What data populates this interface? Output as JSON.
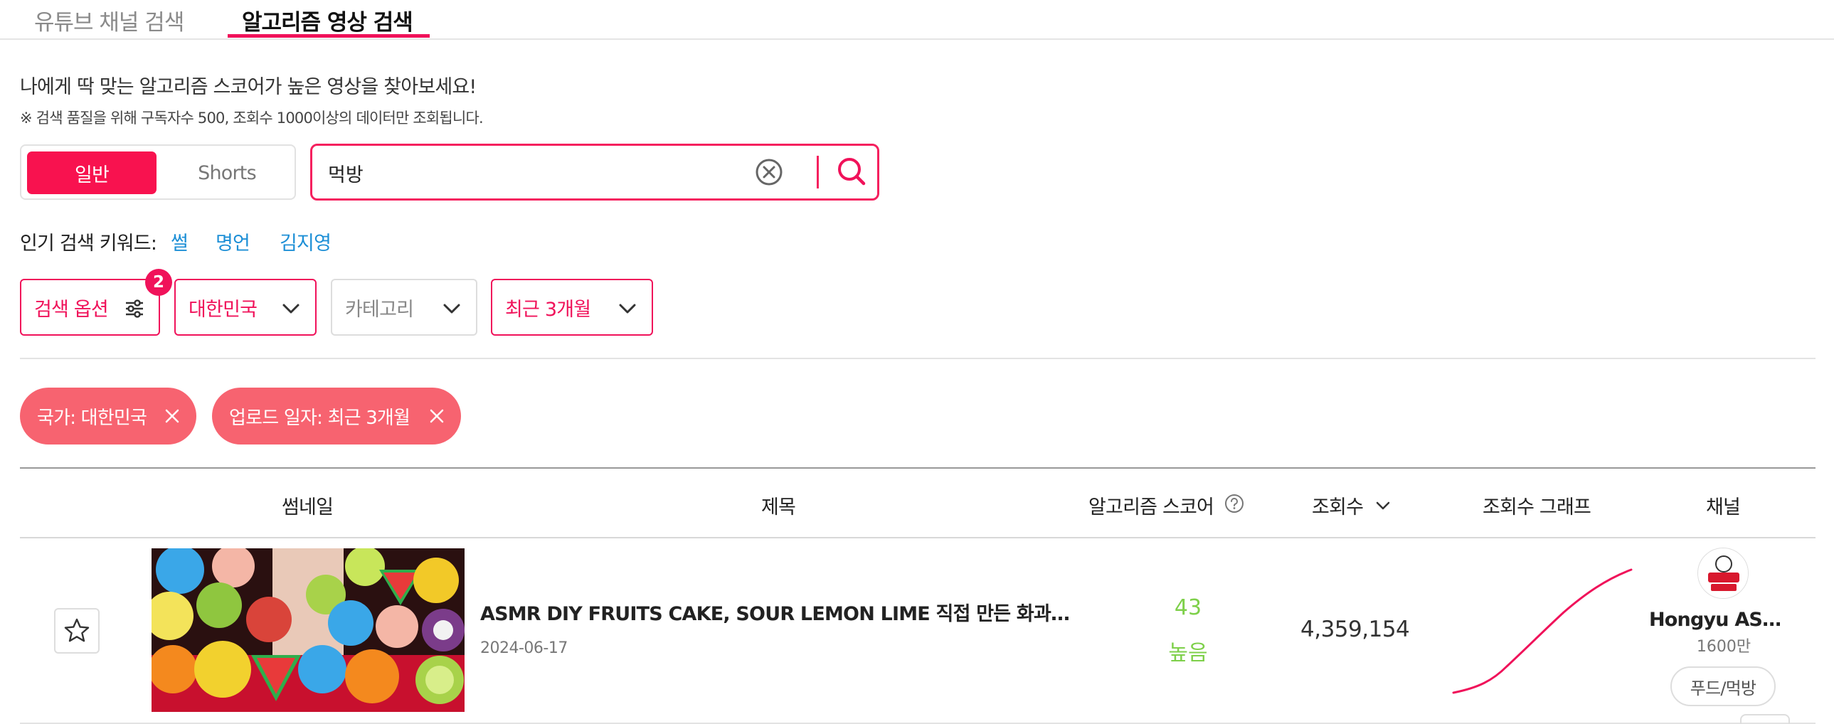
{
  "tabs": [
    {
      "label": "유튜브 채널 검색",
      "active": false
    },
    {
      "label": "알고리즘 영상 검색",
      "active": true
    }
  ],
  "intro": {
    "headline": "나에게 딱 맞는 알고리즘 스코어가 높은 영상을 찾아보세요!",
    "notice": "※ 검색 품질을 위해 구독자수 500, 조회수 1000이상의 데이터만 조회됩니다."
  },
  "type_toggle": {
    "options": [
      "일반",
      "Shorts"
    ],
    "selected": "일반"
  },
  "search": {
    "value": "먹방",
    "placeholder": ""
  },
  "popular_keywords": {
    "label": "인기 검색 키워드:",
    "items": [
      "썰",
      "명언",
      "김지영"
    ]
  },
  "filters": {
    "options_label": "검색 옵션",
    "options_badge": "2",
    "country": "대한민국",
    "category": "카테고리",
    "period": "최근 3개월"
  },
  "active_chips": [
    {
      "label": "국가: 대한민국"
    },
    {
      "label": "업로드 일자: 최근 3개월"
    }
  ],
  "table": {
    "headers": {
      "thumbnail": "썸네일",
      "title": "제목",
      "algo_score": "알고리즘 스코어",
      "views": "조회수",
      "views_graph": "조회수 그래프",
      "channel": "채널"
    },
    "rows": [
      {
        "title": "ASMR DIY FRUITS CAKE, SOUR LEMON LIME 직접 만든 화과자, 레몬 라임 먹방",
        "date": "2024-06-17",
        "score": "43",
        "score_level": "높음",
        "views": "4,359,154",
        "channel_name": "Hongyu ASMR 홍유",
        "subscribers": "1600만",
        "category": "푸드/먹방",
        "score_color": "#7ed04a",
        "graph_color": "#f0125a"
      }
    ]
  },
  "colors": {
    "accent": "#f0125a",
    "chip_bg": "#f76370",
    "keyword_link": "#1d8fd6",
    "score_high": "#7ed04a"
  }
}
